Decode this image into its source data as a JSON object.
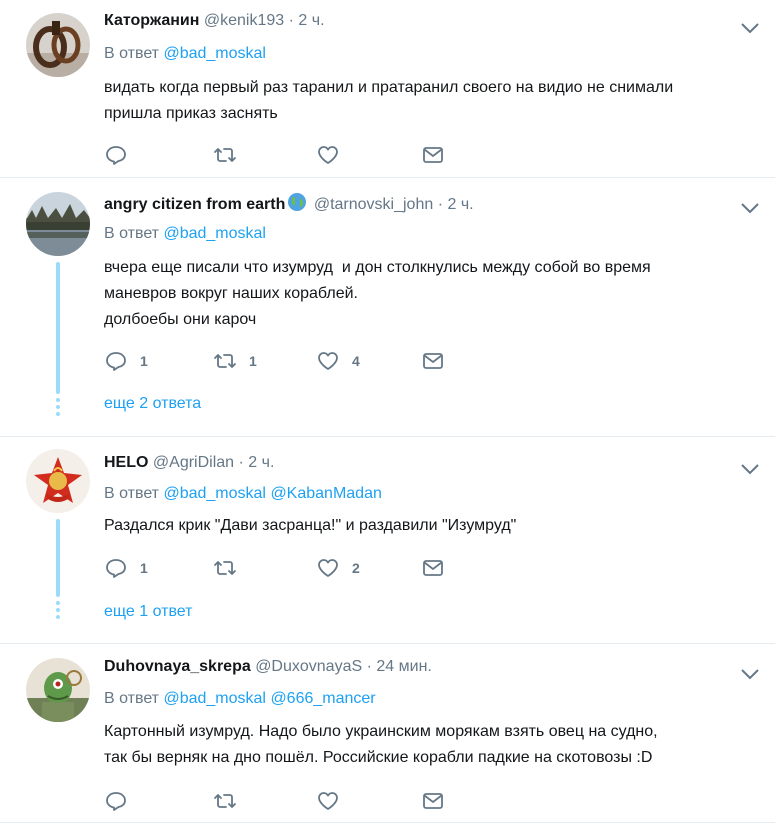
{
  "tweets": [
    {
      "name": "Каторжанин",
      "handle": "@kenik193",
      "dot": "·",
      "time": "2 ч.",
      "reply_prefix": "В ответ",
      "mentions": [
        "@bad_moskal"
      ],
      "text": "видать когда первый раз таранил и пратаранил своего на видио не снимали\nпришла приказ заснять",
      "counts": {
        "reply": "",
        "retweet": "",
        "like": ""
      },
      "avatar_icon": "chains-icon"
    },
    {
      "name": "angry citizen from earth",
      "handle": "@tarnovski_john",
      "dot": "·",
      "time": "2 ч.",
      "reply_prefix": "В ответ",
      "mentions": [
        "@bad_moskal"
      ],
      "text": "вчера еще писали что изумруд  и дон столкнулись между собой во время\nманевров вокруг наших кораблей.\nдолбоебы они кароч",
      "counts": {
        "reply": "1",
        "retweet": "1",
        "like": "4"
      },
      "more_replies": "еще 2 ответа",
      "avatar_icon": "lake-landscape-icon",
      "emoji_icon": "globe-emoji-icon"
    },
    {
      "name": "HELO",
      "handle": "@AgriDilan",
      "dot": "·",
      "time": "2 ч.",
      "reply_prefix": "В ответ",
      "mentions": [
        "@bad_moskal",
        "@KabanMadan"
      ],
      "text": "Раздался крик \"Дави засранца!\" и раздавили \"Изумруд\"",
      "counts": {
        "reply": "1",
        "retweet": "",
        "like": "2"
      },
      "more_replies": "еще 1 ответ",
      "avatar_icon": "pioneer-badge-icon"
    },
    {
      "name": "Duhovnaya_skrepa",
      "handle": "@DuxovnayaS",
      "dot": "·",
      "time": "24 мин.",
      "reply_prefix": "В ответ",
      "mentions": [
        "@bad_moskal",
        "@666_mancer"
      ],
      "text": "Картонный изумруд. Надо было украинским морякам взять овец на судно,\nтак бы верняк на дно пошёл. Российские корабли падкие на скотовозы :D",
      "counts": {
        "reply": "",
        "retweet": "",
        "like": ""
      },
      "avatar_icon": "cartoon-character-icon"
    }
  ],
  "colors": {
    "accent": "#1da1f2",
    "muted": "#657786",
    "thread": "#9bdcfb",
    "divider": "#e6ecf0"
  }
}
